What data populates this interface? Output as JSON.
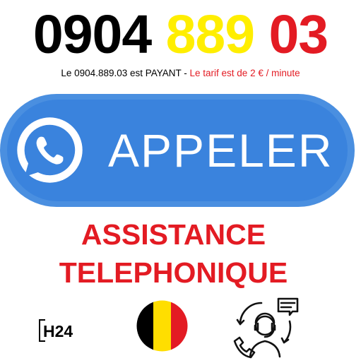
{
  "phone": {
    "part1": "0904",
    "part2": "889",
    "part3": "03"
  },
  "tariff": {
    "text_black": "Le 0904.889.03 est PAYANT - ",
    "text_red": "Le tarif est de 2 € / minute"
  },
  "call_button": {
    "label": "APPELER",
    "icon": "whatsapp-phone-icon"
  },
  "assistance": {
    "line1": "ASSISTANCE",
    "line2": "TELEPHONIQUE"
  },
  "icons": {
    "h24_text": "H24",
    "flag": "belgium-flag-icon",
    "support": "customer-support-icon"
  },
  "colors": {
    "black": "#000000",
    "yellow": "#ffee00",
    "red": "#e31b23",
    "blue": "#3a83dd"
  }
}
